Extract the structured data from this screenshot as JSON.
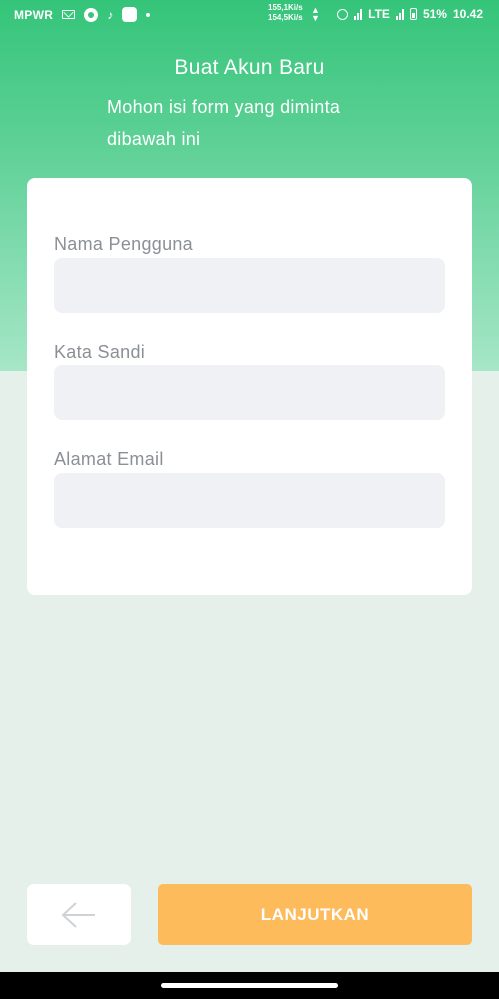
{
  "status_bar": {
    "carrier": "MPWR",
    "tiktok_glyph": "♪",
    "net_up": "155,1Ki/s",
    "net_down": "154,5Ki/s",
    "network_type": "LTE",
    "battery": "51%",
    "time": "10.42",
    "icons": [
      "gmail-icon",
      "whatsapp-icon",
      "tiktok-icon",
      "app-icon",
      "dot-icon",
      "alarm-icon",
      "signal-icon",
      "battery-icon"
    ]
  },
  "header": {
    "title": "Buat Akun Baru",
    "subtitle": "Mohon isi form yang diminta dibawah ini"
  },
  "form": {
    "username_label": "Nama Pengguna",
    "username_value": "",
    "password_label": "Kata Sandi",
    "password_value": "",
    "email_label": "Alamat Email",
    "email_value": ""
  },
  "footer": {
    "back_icon": "arrow-left-icon",
    "next_label": "LANJUTKAN"
  },
  "colors": {
    "primary_green": "#34c479",
    "background": "#e6f0eb",
    "field_bg": "#f0f1f4",
    "button_orange": "#fdbb5c"
  }
}
